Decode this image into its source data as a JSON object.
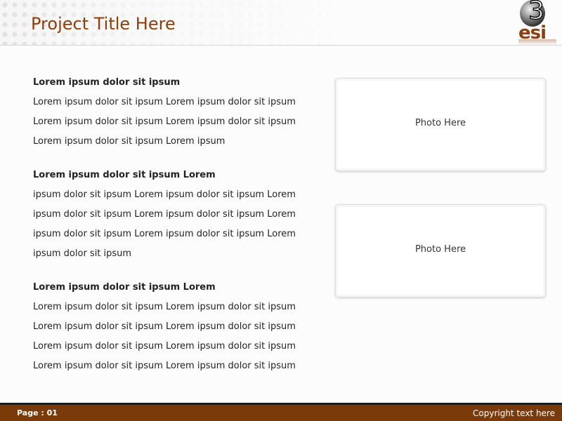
{
  "header": {
    "title": "Project Title Here",
    "logo_digit": "3",
    "logo_text": "esi"
  },
  "content": {
    "sections": [
      {
        "heading": "Lorem ipsum dolor sit ipsum",
        "lines": [
          "Lorem ipsum dolor sit ipsum Lorem ipsum dolor sit ipsum",
          "Lorem ipsum dolor sit ipsum Lorem ipsum dolor sit ipsum",
          "Lorem ipsum dolor sit ipsum Lorem ipsum"
        ]
      },
      {
        "heading": "Lorem ipsum dolor sit ipsum Lorem",
        "lines": [
          "ipsum dolor sit ipsum Lorem ipsum dolor sit ipsum Lorem",
          "ipsum dolor sit ipsum Lorem ipsum dolor sit ipsum Lorem",
          "ipsum dolor sit ipsum Lorem ipsum dolor sit ipsum Lorem",
          "ipsum dolor sit ipsum"
        ]
      },
      {
        "heading": "Lorem ipsum dolor sit ipsum Lorem",
        "lines": [
          "Lorem ipsum dolor sit ipsum Lorem ipsum dolor sit ipsum",
          "Lorem ipsum dolor sit ipsum Lorem ipsum dolor sit ipsum",
          "Lorem ipsum dolor sit ipsum Lorem ipsum dolor sit ipsum",
          "Lorem ipsum dolor sit ipsum Lorem ipsum dolor sit ipsum"
        ]
      }
    ]
  },
  "photos": [
    {
      "label": "Photo Here"
    },
    {
      "label": "Photo Here"
    }
  ],
  "footer": {
    "page": "Page : 01",
    "copyright": "Copyright text here"
  },
  "colors": {
    "accent": "#8b3f0c",
    "footer_bg": "#7a3a0a",
    "footer_border": "#1c1c1c"
  }
}
